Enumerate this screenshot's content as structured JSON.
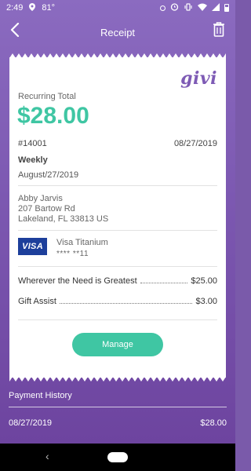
{
  "status_bar": {
    "time": "2:49",
    "temperature": "81°",
    "icons": [
      "location-icon",
      "dot-icon",
      "alarm-icon",
      "vibrate-icon",
      "wifi-icon",
      "signal-icon",
      "battery-icon"
    ]
  },
  "header": {
    "title": "Receipt",
    "back_icon": "chevron-left-icon",
    "delete_icon": "trash-icon"
  },
  "receipt": {
    "logo": "givi",
    "recurring_label": "Recurring Total",
    "total": "$28.00",
    "order_number": "#14001",
    "order_date": "08/27/2019",
    "frequency": "Weekly",
    "frequency_date": "August/27/2019",
    "address": {
      "name": "Abby Jarvis",
      "street": "207 Bartow Rd",
      "city": "Lakeland, FL 33813 US"
    },
    "card": {
      "brand_badge": "VISA",
      "name": "Visa Titanium",
      "number": "**** **11"
    },
    "items": [
      {
        "label": "Wherever the Need is Greatest",
        "amount": "$25.00"
      },
      {
        "label": "Gift Assist",
        "amount": "$3.00"
      }
    ],
    "manage_label": "Manage"
  },
  "payment_history": {
    "title": "Payment History",
    "rows": [
      {
        "date": "08/27/2019",
        "amount": "$28.00"
      }
    ]
  },
  "colors": {
    "brand_purple": "#7e5bb5",
    "accent_green": "#3fc6a3",
    "visa_blue": "#1d3f9b"
  }
}
